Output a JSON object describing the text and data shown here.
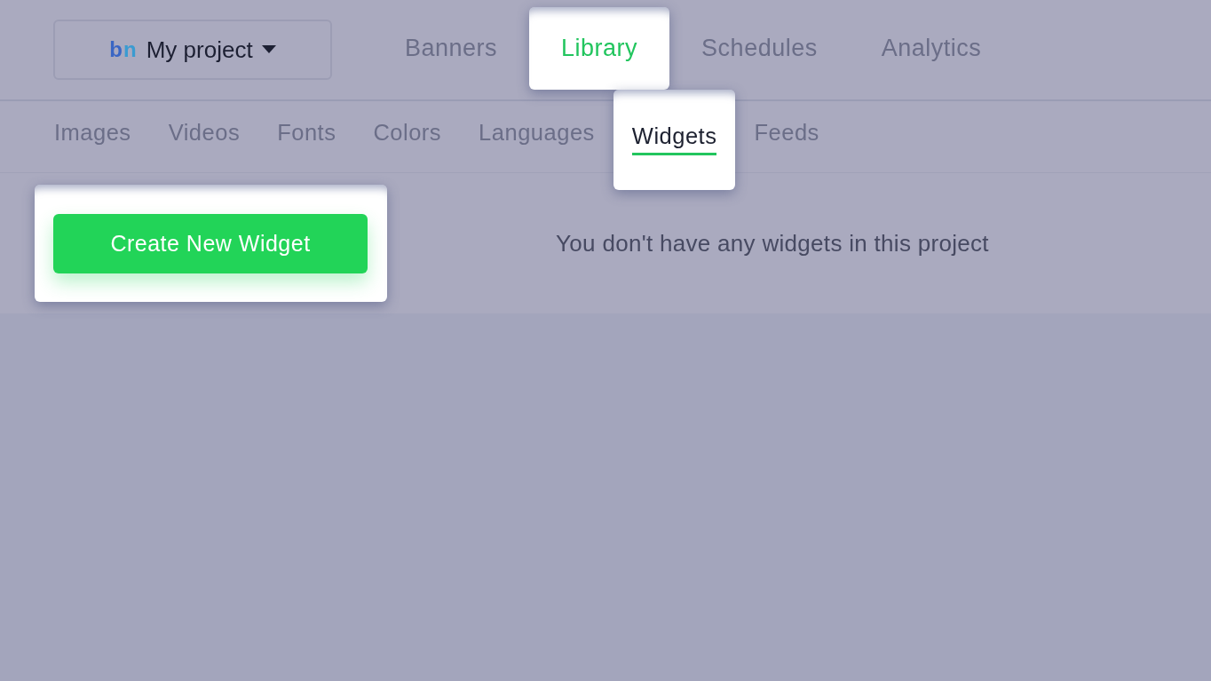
{
  "project_switcher": {
    "logo": "bn",
    "label": "My project"
  },
  "tabs": [
    {
      "label": "Banners",
      "selected": false,
      "highlighted": false
    },
    {
      "label": "Library",
      "selected": true,
      "highlighted": true
    },
    {
      "label": "Schedules",
      "selected": false,
      "highlighted": false
    },
    {
      "label": "Analytics",
      "selected": false,
      "highlighted": false
    }
  ],
  "subtabs": [
    {
      "label": "Images",
      "selected": false,
      "highlighted": false
    },
    {
      "label": "Videos",
      "selected": false,
      "highlighted": false
    },
    {
      "label": "Fonts",
      "selected": false,
      "highlighted": false
    },
    {
      "label": "Colors",
      "selected": false,
      "highlighted": false
    },
    {
      "label": "Languages",
      "selected": false,
      "highlighted": false
    },
    {
      "label": "Widgets",
      "selected": true,
      "highlighted": true
    },
    {
      "label": "Feeds",
      "selected": false,
      "highlighted": false
    }
  ],
  "create_button": {
    "label": "Create New Widget",
    "highlighted": true
  },
  "empty_message": "You don't have any widgets in this project"
}
